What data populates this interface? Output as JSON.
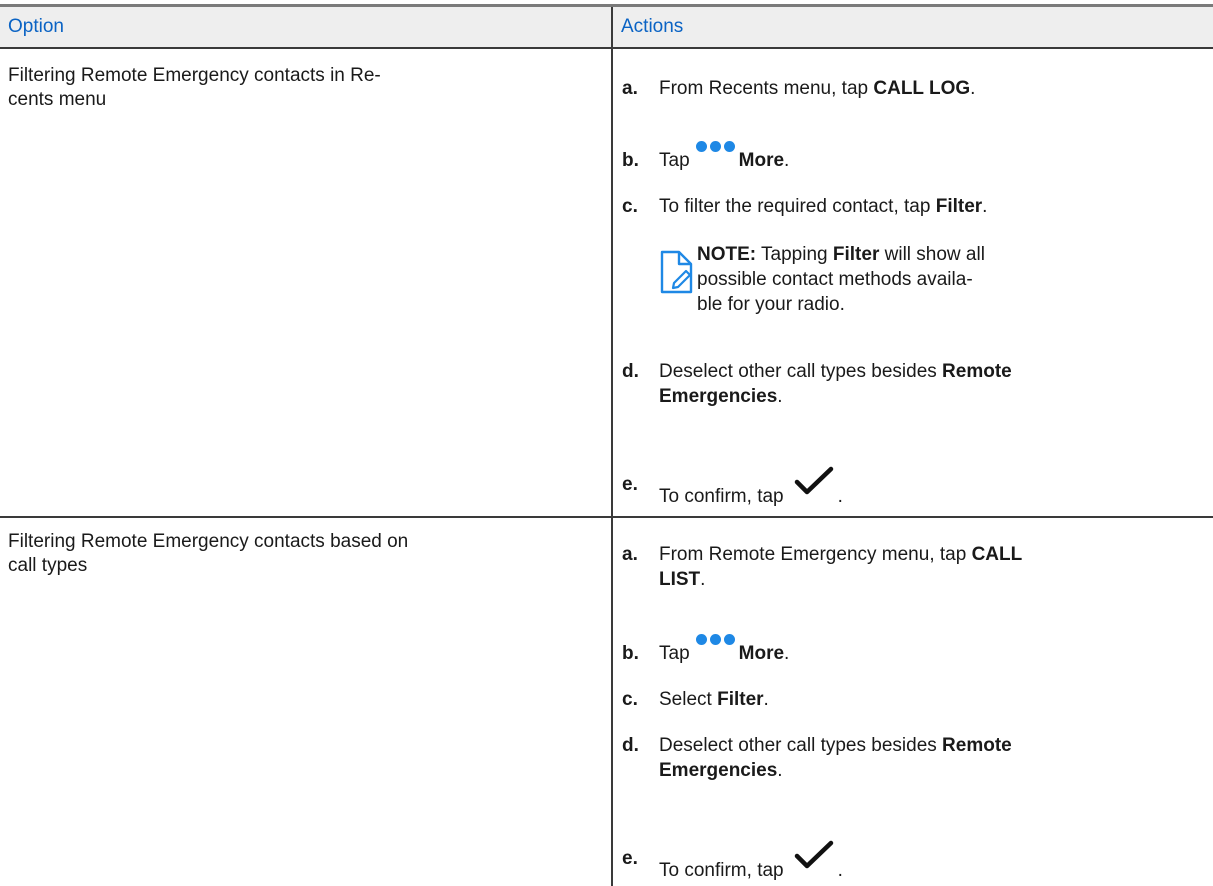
{
  "table": {
    "headers": [
      "Option",
      "Actions"
    ],
    "rows": [
      {
        "option": "Filtering Remote Emergency contacts in Re-\ncents menu",
        "option_line1": "Filtering Remote Emergency contacts in Re-",
        "option_line2": "cents menu",
        "steps": {
          "a": {
            "letter": "a.",
            "pre": "From Recents menu, tap ",
            "bold": "CALL LOG",
            "post": "."
          },
          "b": {
            "letter": "b.",
            "pre": "Tap",
            "bold": "More",
            "post": ".",
            "icon": "more-dots-icon"
          },
          "c": {
            "letter": "c.",
            "pre": "To filter the required contact, tap ",
            "bold": "Filter",
            "post": "."
          },
          "note": {
            "label": "NOTE:",
            "pre": " Tapping ",
            "bold": "Filter",
            "post1": " will show all",
            "line2": "possible contact methods availa-",
            "line3": "ble for your radio."
          },
          "d": {
            "letter": "d.",
            "pre": "Deselect other call types besides ",
            "bold1": "Remote",
            "bold2": "Emergencies",
            "post": "."
          },
          "e": {
            "letter": "e.",
            "pre": "To confirm, tap",
            "post": ".",
            "icon": "checkmark-icon"
          }
        }
      },
      {
        "option_line1": "Filtering Remote Emergency contacts based on",
        "option_line2": "call types",
        "steps": {
          "a": {
            "letter": "a.",
            "pre": "From Remote Emergency menu, tap ",
            "bold1": "CALL",
            "bold2": "LIST",
            "post": "."
          },
          "b": {
            "letter": "b.",
            "pre": "Tap",
            "bold": "More",
            "post": ".",
            "icon": "more-dots-icon"
          },
          "c": {
            "letter": "c.",
            "pre": "Select ",
            "bold": "Filter",
            "post": "."
          },
          "d": {
            "letter": "d.",
            "pre": "Deselect other call types besides ",
            "bold1": "Remote",
            "bold2": "Emergencies",
            "post": "."
          },
          "e": {
            "letter": "e.",
            "pre": "To confirm, tap",
            "post": ".",
            "icon": "checkmark-icon"
          }
        }
      }
    ]
  },
  "colors": {
    "header_text": "#0a63c4",
    "dots": "#1e88e5",
    "note_icon": "#1e88e5"
  }
}
